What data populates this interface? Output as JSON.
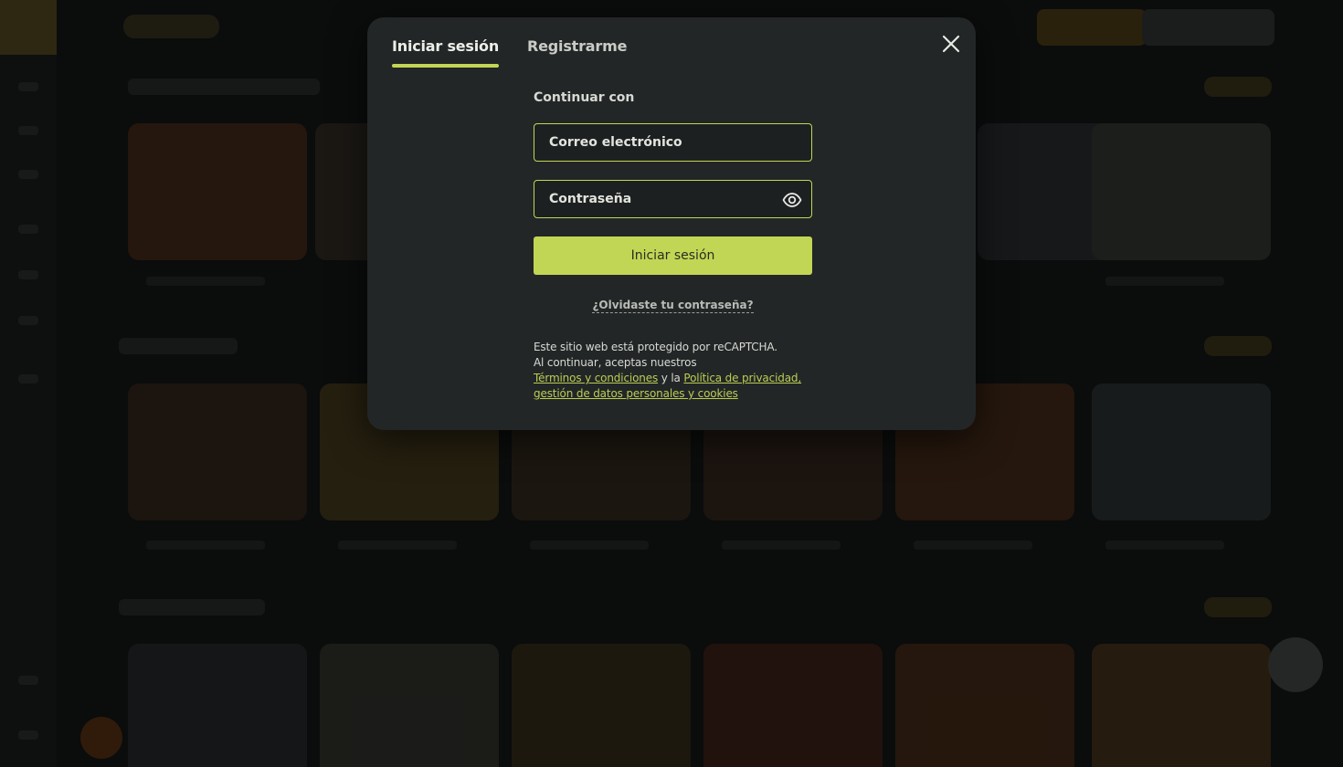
{
  "tabs": [
    {
      "label": "Iniciar sesión",
      "active": true
    },
    {
      "label": "Registrarme",
      "active": false
    }
  ],
  "form": {
    "continue_label": "Continuar con",
    "email_placeholder": "Correo electrónico",
    "password_placeholder": "Contraseña",
    "submit_label": "Iniciar sesión",
    "forgot_label": "¿Olvidaste tu contraseña?"
  },
  "legal": {
    "line1": "Este sitio web está protegido por reCAPTCHA.",
    "line2": "Al continuar, aceptas nuestros",
    "terms_link": "Términos y condiciones",
    "connector": " y la ",
    "privacy_link": "Política de privacidad,",
    "privacy_link2": "gestión de datos personales y cookies"
  },
  "icons": {
    "close": "close-icon",
    "password_toggle": "eye-icon"
  },
  "colors": {
    "accent": "#c2d655",
    "modal_bg": "#232626",
    "link": "#b9cd55"
  }
}
